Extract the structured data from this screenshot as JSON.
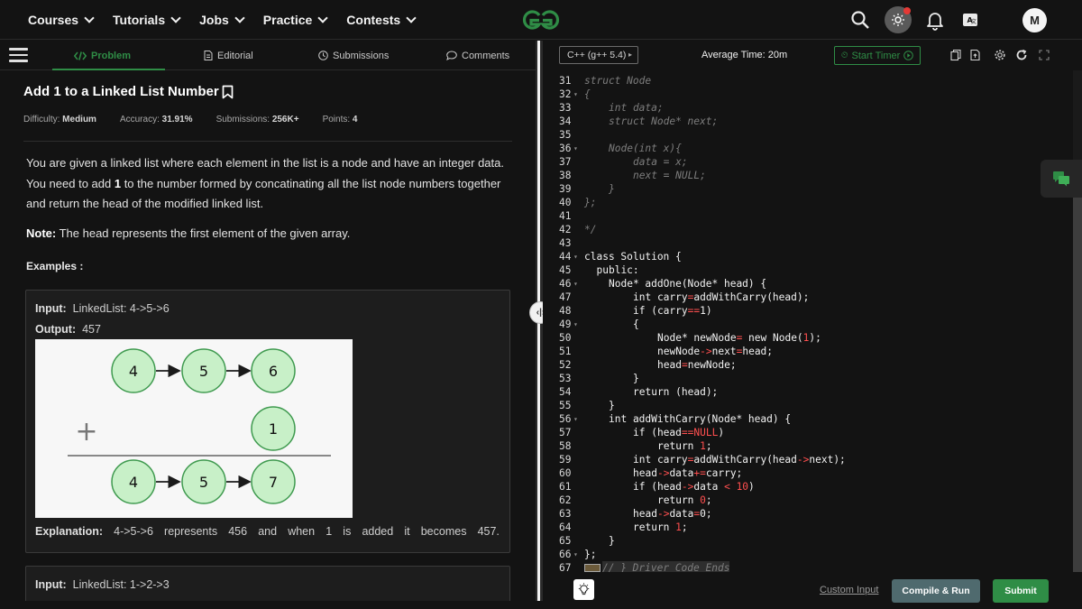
{
  "nav": {
    "menu": [
      {
        "label": "Courses"
      },
      {
        "label": "Tutorials"
      },
      {
        "label": "Jobs"
      },
      {
        "label": "Practice"
      },
      {
        "label": "Contests"
      }
    ],
    "avatar_initial": "M",
    "icons": [
      "search-icon",
      "theme-toggle-icon",
      "bell-icon",
      "translate-icon"
    ]
  },
  "tabs": {
    "problem": "Problem",
    "editorial": "Editorial",
    "submissions": "Submissions",
    "comments": "Comments"
  },
  "problem": {
    "title": "Add 1 to a Linked List Number",
    "difficulty_label": "Difficulty:",
    "difficulty": "Medium",
    "accuracy_label": "Accuracy:",
    "accuracy": "31.91%",
    "submissions_label": "Submissions:",
    "submissions": "256K+",
    "points_label": "Points:",
    "points": "4",
    "desc_1": "You are given a linked list where each element in the list is a node and have an integer data. You need to add ",
    "desc_bold": "1",
    "desc_2": " to the number formed by concatinating all the list node numbers together and return the head of the modified linked list.",
    "note_label": "Note:",
    "note_text": " The head represents the first element of the given array.",
    "examples_label": "Examples :"
  },
  "example1": {
    "input_label": "Input:",
    "input_value": "LinkedList:  4->5->6",
    "output_label": "Output:",
    "output_value": "457",
    "explanation_label": "Explanation:",
    "explanation_words": [
      "4->5->6",
      "represents",
      "456",
      "and",
      "when",
      "1",
      "is",
      "added",
      "it",
      "becomes",
      "457."
    ],
    "diagram": {
      "row1": [
        "4",
        "5",
        "6"
      ],
      "plus": "+",
      "addend": "1",
      "row2": [
        "4",
        "5",
        "7"
      ]
    }
  },
  "example2": {
    "input_label": "Input:",
    "input_value": "LinkedList:  1->2->3"
  },
  "editor": {
    "language": "C++ (g++ 5.4)",
    "average_time": "Average Time: 20m",
    "start_timer": "Start Timer",
    "lines": [
      {
        "n": "31",
        "fold": false,
        "indent": 0,
        "text": "struct Node",
        "style": "cmt"
      },
      {
        "n": "32",
        "fold": true,
        "indent": 0,
        "text": "{",
        "style": "cmt"
      },
      {
        "n": "33",
        "fold": false,
        "indent": 4,
        "text": "int data;",
        "style": "cmt"
      },
      {
        "n": "34",
        "fold": false,
        "indent": 4,
        "text": "struct Node* next;",
        "style": "cmt"
      },
      {
        "n": "35",
        "fold": false,
        "indent": 0,
        "text": "",
        "style": "cmt"
      },
      {
        "n": "36",
        "fold": true,
        "indent": 4,
        "text": "Node(int x){",
        "style": "cmt"
      },
      {
        "n": "37",
        "fold": false,
        "indent": 8,
        "text": "data = x;",
        "style": "cmt"
      },
      {
        "n": "38",
        "fold": false,
        "indent": 8,
        "text": "next = NULL;",
        "style": "cmt"
      },
      {
        "n": "39",
        "fold": false,
        "indent": 4,
        "text": "}",
        "style": "cmt"
      },
      {
        "n": "40",
        "fold": false,
        "indent": 0,
        "text": "};",
        "style": "cmt"
      },
      {
        "n": "41",
        "fold": false,
        "indent": 0,
        "text": "",
        "style": "cmt"
      },
      {
        "n": "42",
        "fold": false,
        "indent": 0,
        "text": "*/",
        "style": "cmt"
      },
      {
        "n": "43",
        "fold": false,
        "indent": 0,
        "text": "",
        "style": "code"
      },
      {
        "n": "44",
        "fold": true,
        "indent": 0,
        "text": "class Solution {",
        "style": "code"
      },
      {
        "n": "45",
        "fold": false,
        "indent": 2,
        "text": "public:",
        "style": "code"
      },
      {
        "n": "46",
        "fold": true,
        "indent": 4,
        "text": "Node* addOne(Node* head) {",
        "style": "code"
      },
      {
        "n": "47",
        "fold": false,
        "indent": 8,
        "text": "int carry=addWithCarry(head);",
        "style": "code"
      },
      {
        "n": "48",
        "fold": false,
        "indent": 8,
        "text": "if (carry==1)",
        "style": "code"
      },
      {
        "n": "49",
        "fold": true,
        "indent": 8,
        "text": "{",
        "style": "code"
      },
      {
        "n": "50",
        "fold": false,
        "indent": 12,
        "text": "Node* newNode= new Node(1);",
        "style": "code"
      },
      {
        "n": "51",
        "fold": false,
        "indent": 12,
        "text": "newNode->next=head;",
        "style": "code"
      },
      {
        "n": "52",
        "fold": false,
        "indent": 12,
        "text": "head=newNode;",
        "style": "code"
      },
      {
        "n": "53",
        "fold": false,
        "indent": 8,
        "text": "}",
        "style": "code"
      },
      {
        "n": "54",
        "fold": false,
        "indent": 8,
        "text": "return (head);",
        "style": "code"
      },
      {
        "n": "55",
        "fold": false,
        "indent": 4,
        "text": "}",
        "style": "code"
      },
      {
        "n": "56",
        "fold": true,
        "indent": 4,
        "text": "int addWithCarry(Node* head) {",
        "style": "code"
      },
      {
        "n": "57",
        "fold": false,
        "indent": 8,
        "text": "if (head==NULL)",
        "style": "code"
      },
      {
        "n": "58",
        "fold": false,
        "indent": 12,
        "text": "return 1;",
        "style": "code"
      },
      {
        "n": "59",
        "fold": false,
        "indent": 8,
        "text": "int carry=addWithCarry(head->next);",
        "style": "code"
      },
      {
        "n": "60",
        "fold": false,
        "indent": 8,
        "text": "head->data+=carry;",
        "style": "code"
      },
      {
        "n": "61",
        "fold": false,
        "indent": 8,
        "text": "if (head->data < 10)",
        "style": "code"
      },
      {
        "n": "62",
        "fold": false,
        "indent": 12,
        "text": "return 0;",
        "style": "code"
      },
      {
        "n": "63",
        "fold": false,
        "indent": 8,
        "text": "head->data=0;",
        "style": "code"
      },
      {
        "n": "64",
        "fold": false,
        "indent": 8,
        "text": "return 1;",
        "style": "code"
      },
      {
        "n": "65",
        "fold": false,
        "indent": 4,
        "text": "}",
        "style": "code"
      },
      {
        "n": "66",
        "fold": true,
        "indent": 0,
        "text": "};",
        "style": "code"
      },
      {
        "n": "67",
        "fold": false,
        "indent": 0,
        "text": "// } Driver Code Ends",
        "style": "cmt"
      }
    ]
  },
  "bottom": {
    "custom_input": "Custom Input",
    "compile_run": "Compile & Run",
    "submit": "Submit"
  },
  "colors": {
    "accent": "#2f8d46",
    "background": "#131313",
    "operator": "#ff4f4f",
    "node_fill": "#c8f0c8",
    "node_stroke": "#3f9a4f"
  }
}
